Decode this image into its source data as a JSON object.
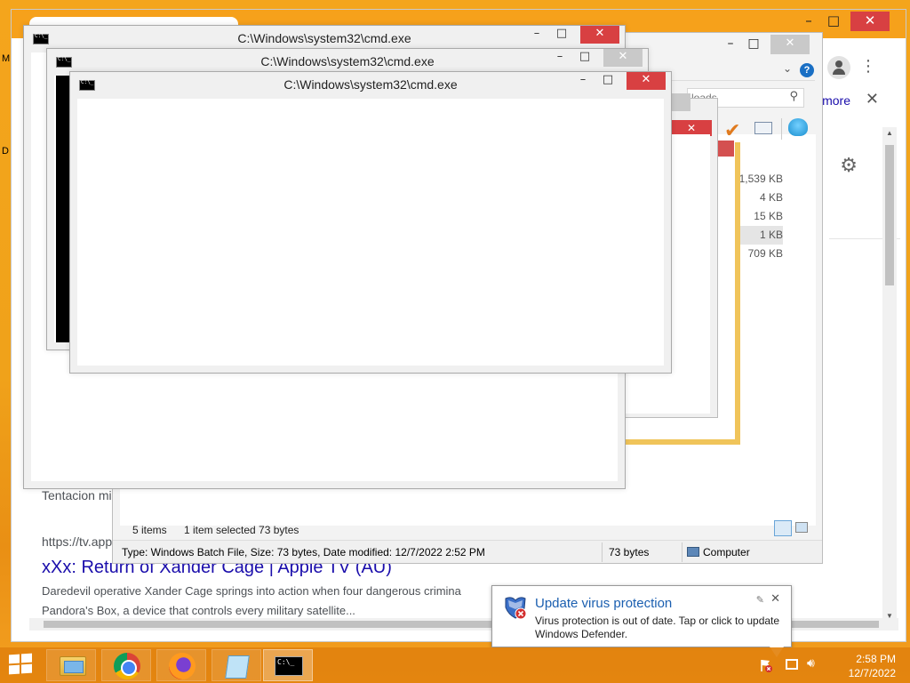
{
  "browser": {
    "more_label": "more",
    "snippet1": "Tentacion mig",
    "url_text": "https://tv.appl",
    "result_title": "xXx: Return of Xander Cage | Apple TV (AU)",
    "desc_line1": "Daredevil operative Xander Cage springs into action when four dangerous crimina",
    "desc_line2": "Pandora's Box, a device that controls every military satellite...",
    "left_edge_1": "M",
    "left_edge_2": "D"
  },
  "explorer": {
    "search_placeholder": "loads",
    "sizes": [
      "1,539 KB",
      "4 KB",
      "15 KB",
      "1 KB",
      "709 KB"
    ],
    "status_items": "5 items",
    "status_selected": "1 item selected  73 bytes",
    "details_type": "Type: Windows Batch File, Size: 73 bytes, Date modified: 12/7/2022 2:52 PM",
    "details_size": "73 bytes",
    "details_location": "Computer"
  },
  "cmd_windows": [
    {
      "title": "C:\\Windows\\system32\\cmd.exe"
    },
    {
      "title": "C:\\Windows\\system32\\cmd.exe"
    },
    {
      "title": "C:\\Windows\\system32\\cmd.exe"
    }
  ],
  "notification": {
    "title": "Update virus protection",
    "body": "Virus protection is out of date. Tap or click to update Windows Defender."
  },
  "taskbar": {
    "apps": [
      "file-explorer",
      "google-chrome",
      "firefox",
      "notepad",
      "command-prompt"
    ],
    "time": "2:58 PM",
    "date": "12/7/2022"
  },
  "colors": {
    "desktop": "#f4a51c",
    "close_red": "#d84042",
    "link_blue": "#1a0dab"
  }
}
